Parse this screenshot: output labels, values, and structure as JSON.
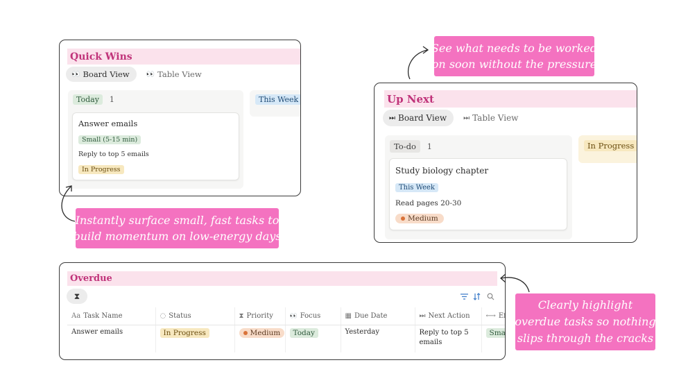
{
  "quick_wins": {
    "title": "Quick Wins",
    "tabs": [
      {
        "icon": "binoculars-icon",
        "glyph": "👀",
        "label": "Board View"
      },
      {
        "icon": "binoculars-icon",
        "glyph": "👀",
        "label": "Table View"
      }
    ],
    "column1": {
      "name": "Today",
      "count": "1"
    },
    "column2": {
      "name": "This Week"
    },
    "card": {
      "title": "Answer emails",
      "size_tag": "Small (5-15 min)",
      "note": "Reply to top 5 emails",
      "status": "In Progress"
    }
  },
  "up_next": {
    "title": "Up Next",
    "tabs": [
      {
        "icon": "next-track-icon",
        "glyph": "⏭",
        "label": "Board View"
      },
      {
        "icon": "next-track-icon",
        "glyph": "⏭",
        "label": "Table View"
      }
    ],
    "column1": {
      "name": "To-do",
      "count": "1"
    },
    "column2": {
      "name": "In Progress"
    },
    "card": {
      "title": "Study biology chapter",
      "focus_tag": "This Week",
      "note": "Read pages 20-30",
      "priority": "Medium"
    }
  },
  "overdue": {
    "title": "Overdue",
    "view_icon": "hourglass-icon",
    "columns": [
      {
        "icon": "text-icon",
        "glyph": "Aa",
        "label": "Task Name"
      },
      {
        "icon": "status-icon",
        "glyph": "◌",
        "label": "Status"
      },
      {
        "icon": "hourglass-icon",
        "glyph": "⧗",
        "label": "Priority"
      },
      {
        "icon": "binoculars-icon",
        "glyph": "👀",
        "label": "Focus"
      },
      {
        "icon": "calendar-icon",
        "glyph": "▦",
        "label": "Due Date"
      },
      {
        "icon": "next-track-icon",
        "glyph": "⏭",
        "label": "Next Action"
      },
      {
        "icon": "dumbbell-icon",
        "glyph": "⟷",
        "label": "Ef"
      }
    ],
    "row": {
      "task": "Answer emails",
      "status": "In Progress",
      "priority": "Medium",
      "focus": "Today",
      "due": "Yesterday",
      "next_action": "Reply to top 5 emails",
      "effort": "Smal"
    }
  },
  "callouts": {
    "up_next": [
      "See what needs to be worked",
      "on soon without the pressure"
    ],
    "quick_wins": [
      "Instantly surface small, fast tasks to",
      "build momentum on low-energy days"
    ],
    "overdue": [
      "Clearly highlight",
      "overdue tasks so nothing",
      "slips through the cracks"
    ]
  },
  "colors": {
    "accent": "#f472c0",
    "title_bg": "#fbe2ec",
    "title_text": "#c0337a"
  }
}
